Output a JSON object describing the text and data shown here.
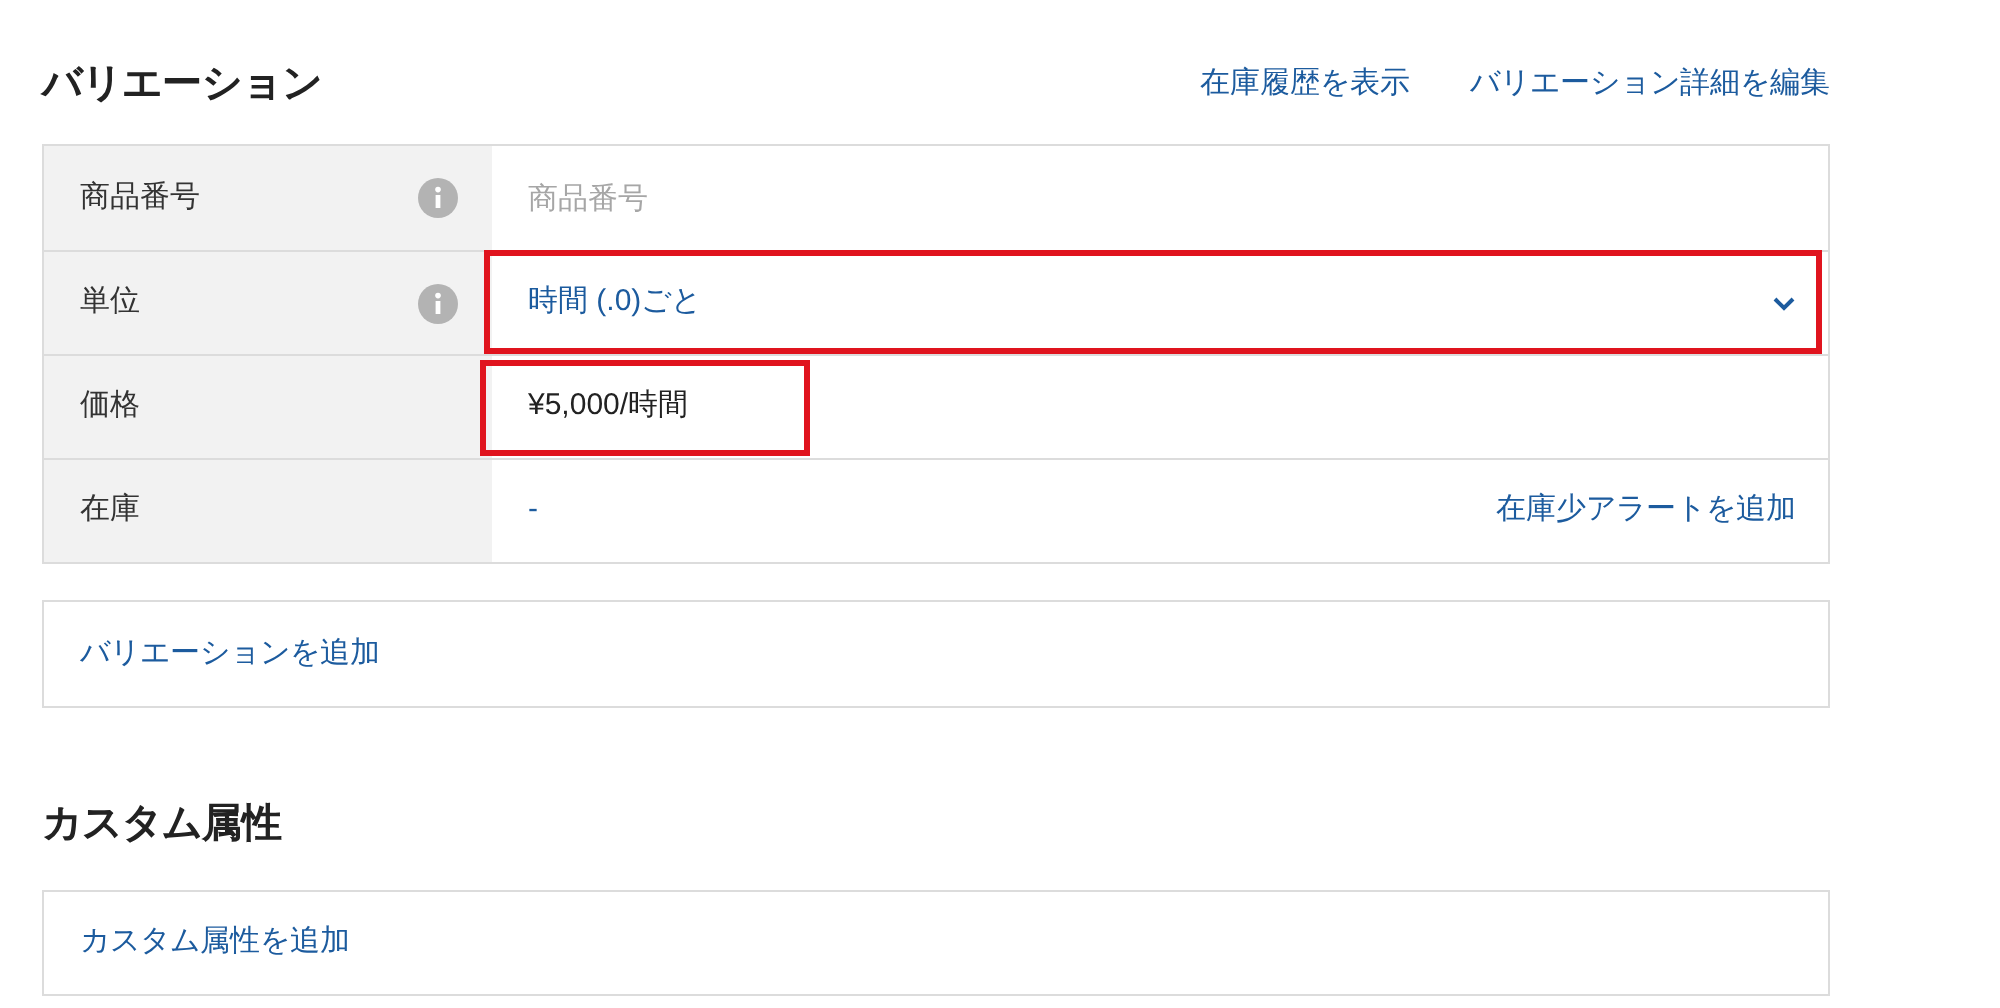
{
  "variations": {
    "title": "バリエーション",
    "links": [
      "在庫履歴を表示",
      "バリエーション詳細を編集"
    ],
    "rows": [
      {
        "label": "商品番号",
        "info": true,
        "kind": "input",
        "placeholder": "商品番号",
        "row_highlighted": false,
        "value_highlighted": false
      },
      {
        "label": "単位",
        "info": true,
        "kind": "select",
        "value": "時間 (.0)ごと",
        "row_highlighted": true,
        "value_highlighted": false
      },
      {
        "label": "価格",
        "info": false,
        "kind": "text",
        "value": "¥5,000/時間",
        "row_highlighted": false,
        "value_highlighted": true
      },
      {
        "label": "在庫",
        "info": false,
        "kind": "stock",
        "value": "-",
        "action": "在庫少アラートを追加",
        "row_highlighted": false,
        "value_highlighted": false
      }
    ],
    "add_button": "バリエーションを追加"
  },
  "custom_attributes": {
    "title": "カスタム属性",
    "add_button": "カスタム属性を追加"
  }
}
